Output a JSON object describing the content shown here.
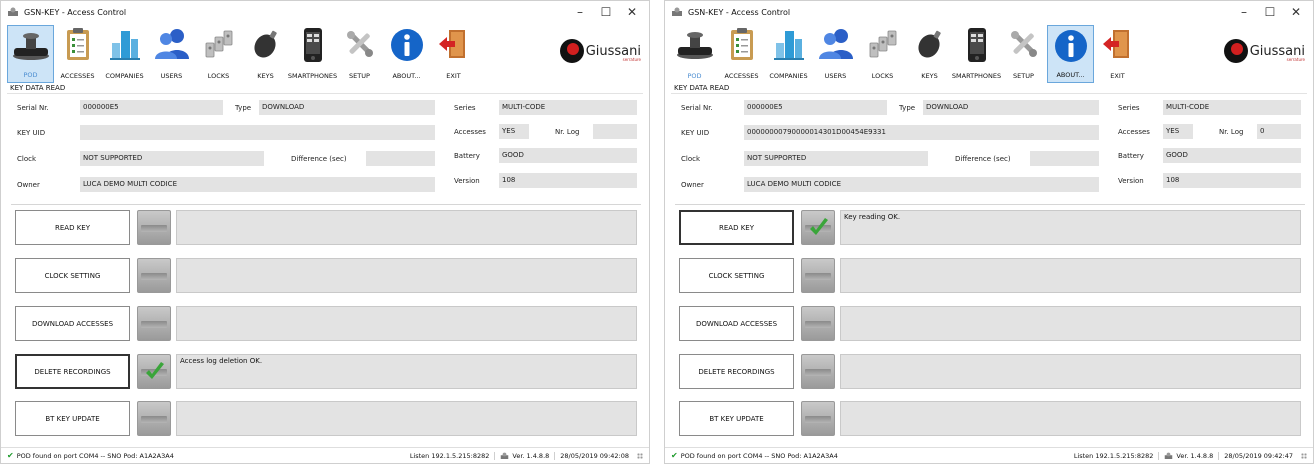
{
  "windows": [
    {
      "title": "GSN-KEY - Access Control",
      "toolbar": [
        {
          "label": "POD",
          "icon": "pod-reader-icon",
          "selected": true
        },
        {
          "label": "ACCESSES",
          "icon": "clipboard-icon"
        },
        {
          "label": "COMPANIES",
          "icon": "buildings-icon"
        },
        {
          "label": "USERS",
          "icon": "users-icon"
        },
        {
          "label": "LOCKS",
          "icon": "locks-icon"
        },
        {
          "label": "KEYS",
          "icon": "key-fob-icon"
        },
        {
          "label": "SMARTPHONES",
          "icon": "smartphone-icon"
        },
        {
          "label": "SETUP",
          "icon": "tools-icon"
        },
        {
          "label": "ABOUT...",
          "icon": "info-icon"
        },
        {
          "label": "EXIT",
          "icon": "exit-door-icon"
        }
      ],
      "brand": "Giussani",
      "brand_sub": "serrature",
      "section_title": "KEY DATA READ",
      "fields": {
        "serial_label": "Serial Nr.",
        "serial": "000000E5",
        "type_label": "Type",
        "type": "DOWNLOAD",
        "series_label": "Series",
        "series": "MULTI-CODE",
        "uid_label": "KEY UID",
        "uid": "",
        "accesses_label": "Accesses",
        "accesses": "YES",
        "nrlog_label": "Nr. Log",
        "nrlog": "",
        "clock_label": "Clock",
        "clock": "NOT SUPPORTED",
        "diff_label": "Difference (sec)",
        "diff": "",
        "battery_label": "Battery",
        "battery": "GOOD",
        "owner_label": "Owner",
        "owner": "LUCA DEMO MULTI CODICE",
        "version_label": "Version",
        "version": "108"
      },
      "actions": [
        {
          "label": "READ KEY",
          "message": "",
          "ok": false
        },
        {
          "label": "CLOCK SETTING",
          "message": "",
          "ok": false
        },
        {
          "label": "DOWNLOAD ACCESSES",
          "message": "",
          "ok": false
        },
        {
          "label": "DELETE RECORDINGS",
          "message": "Access log deletion OK.",
          "ok": true
        },
        {
          "label": "BT KEY UPDATE",
          "message": "",
          "ok": false
        }
      ],
      "status": {
        "left": "POD found on port COM4 -- SNO Pod: A1A2A3A4",
        "listen": "Listen 192.1.5.215:8282",
        "version": "Ver. 1.4.8.8",
        "datetime": "28/05/2019 09:42:08"
      }
    },
    {
      "title": "GSN-KEY - Access Control",
      "toolbar": [
        {
          "label": "POD",
          "icon": "pod-reader-icon"
        },
        {
          "label": "ACCESSES",
          "icon": "clipboard-icon"
        },
        {
          "label": "COMPANIES",
          "icon": "buildings-icon"
        },
        {
          "label": "USERS",
          "icon": "users-icon"
        },
        {
          "label": "LOCKS",
          "icon": "locks-icon"
        },
        {
          "label": "KEYS",
          "icon": "key-fob-icon"
        },
        {
          "label": "SMARTPHONES",
          "icon": "smartphone-icon"
        },
        {
          "label": "SETUP",
          "icon": "tools-icon"
        },
        {
          "label": "ABOUT...",
          "icon": "info-icon",
          "selected": true
        },
        {
          "label": "EXIT",
          "icon": "exit-door-icon"
        }
      ],
      "brand": "Giussani",
      "brand_sub": "serrature",
      "section_title": "KEY DATA READ",
      "fields": {
        "serial_label": "Serial Nr.",
        "serial": "000000E5",
        "type_label": "Type",
        "type": "DOWNLOAD",
        "series_label": "Series",
        "series": "MULTI-CODE",
        "uid_label": "KEY UID",
        "uid": "00000000790000014301D00454E9331",
        "accesses_label": "Accesses",
        "accesses": "YES",
        "nrlog_label": "Nr. Log",
        "nrlog": "0",
        "clock_label": "Clock",
        "clock": "NOT SUPPORTED",
        "diff_label": "Difference (sec)",
        "diff": "",
        "battery_label": "Battery",
        "battery": "GOOD",
        "owner_label": "Owner",
        "owner": "LUCA DEMO MULTI CODICE",
        "version_label": "Version",
        "version": "108"
      },
      "actions": [
        {
          "label": "READ KEY",
          "message": "Key reading OK.",
          "ok": true
        },
        {
          "label": "CLOCK SETTING",
          "message": "",
          "ok": false
        },
        {
          "label": "DOWNLOAD ACCESSES",
          "message": "",
          "ok": false
        },
        {
          "label": "DELETE RECORDINGS",
          "message": "",
          "ok": false
        },
        {
          "label": "BT KEY UPDATE",
          "message": "",
          "ok": false
        }
      ],
      "status": {
        "left": "POD found on port COM4 -- SNO Pod: A1A2A3A4",
        "listen": "Listen 192.1.5.215:8282",
        "version": "Ver. 1.4.8.8",
        "datetime": "28/05/2019 09:42:47"
      }
    }
  ],
  "colors": {
    "ok_green": "#3aa53a",
    "field_bg": "#e3e3e3",
    "selection": "#cde4f7",
    "brand_red": "#d21f1f"
  }
}
